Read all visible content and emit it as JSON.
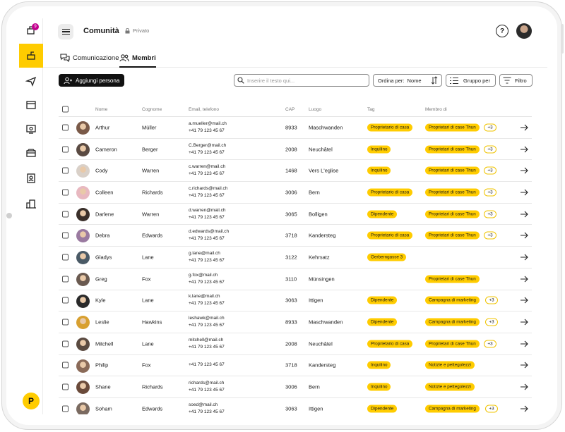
{
  "rail": {
    "items": [
      {
        "name": "notifications-icon",
        "badge": "9"
      },
      {
        "name": "community-icon"
      },
      {
        "name": "send-icon"
      },
      {
        "name": "news-icon"
      },
      {
        "name": "media-icon"
      },
      {
        "name": "inbox-icon"
      },
      {
        "name": "contacts-icon"
      },
      {
        "name": "buildings-icon"
      }
    ],
    "logo": "P"
  },
  "header": {
    "title": "Comunità",
    "privacy": "Privato"
  },
  "tabs": [
    {
      "label": "Comunicazione",
      "active": false
    },
    {
      "label": "Membri",
      "active": true
    }
  ],
  "toolbar": {
    "add_label": "Aggiungi persona",
    "search_placeholder": "Inserire il testo qui...",
    "sort_label": "Ordina per:",
    "sort_value": "Nome",
    "group_label": "Gruppo per",
    "filter_label": "Filtro"
  },
  "columns": [
    "Nome",
    "Cognome",
    "Email, telefono",
    "CAP",
    "Luogo",
    "Tag",
    "Membro di"
  ],
  "colors": {
    "accent": "#ffcc00",
    "badge": "#c2008e"
  },
  "rows": [
    {
      "first": "Arthur",
      "last": "Müller",
      "email": "a.mueller@mail.ch",
      "phone": "+41 79 123 45 67",
      "cap": "8933",
      "city": "Maschwanden",
      "tag": "Proprietario di casa",
      "member": "Proprietari di case Thun",
      "more": "+3",
      "avatar": "#7a5a48"
    },
    {
      "first": "Cameron",
      "last": "Berger",
      "email": "C.Berger@mail.ch",
      "phone": "+41 79 123 45 67",
      "cap": "2008",
      "city": "Neuchâtel",
      "tag": "Inquilino",
      "member": "Proprietari di case Thun",
      "more": "+3",
      "avatar": "#5a4a42"
    },
    {
      "first": "Cody",
      "last": "Warren",
      "email": "c.warren@mail.ch",
      "phone": "+41 79 123 45 67",
      "cap": "1468",
      "city": "Vers L'eglise",
      "tag": "Inquilino",
      "member": "Proprietari di case Thun",
      "more": "+3",
      "avatar": "#d9d0c8"
    },
    {
      "first": "Colleen",
      "last": "Richards",
      "email": "c.richards@mail.ch",
      "phone": "+41 79 123 45 67",
      "cap": "3006",
      "city": "Bern",
      "tag": "Proprietario di casa",
      "member": "Proprietari di case Thun",
      "more": "+3",
      "avatar": "#e8b8c0"
    },
    {
      "first": "Darlene",
      "last": "Warren",
      "email": "d.warren@mail.ch",
      "phone": "+41 79 123 45 67",
      "cap": "3065",
      "city": "Bolligen",
      "tag": "Dipendente",
      "member": "Proprietari di case Thun",
      "more": "+3",
      "avatar": "#3a2f2a"
    },
    {
      "first": "Debra",
      "last": "Edwards",
      "email": "d.edwards@mail.ch",
      "phone": "+41 79 123 45 67",
      "cap": "3718",
      "city": "Kandersteg",
      "tag": "Proprietario di casa",
      "member": "Proprietari di case Thun",
      "more": "+3",
      "avatar": "#9a7aa0"
    },
    {
      "first": "Gladys",
      "last": "Lane",
      "email": "g.lane@mail.ch",
      "phone": "+41 79 123 45 67",
      "cap": "3122",
      "city": "Kehrsatz",
      "tag": "Gerberngasse 3",
      "member": "",
      "more": "",
      "avatar": "#4a5a66"
    },
    {
      "first": "Greg",
      "last": "Fox",
      "email": "g.fox@mail.ch",
      "phone": "+41 79 123 45 67",
      "cap": "3110",
      "city": "Münsingen",
      "tag": "",
      "member": "Proprietari di case Thun",
      "more": "",
      "avatar": "#6a5a50"
    },
    {
      "first": "Kyle",
      "last": "Lane",
      "email": "k.lane@mail.ch",
      "phone": "+41 79 123 45 67",
      "cap": "3063",
      "city": "Ittigen",
      "tag": "Dipendente",
      "member": "Campagna di marketing",
      "more": "+3",
      "avatar": "#2a2a2a"
    },
    {
      "first": "Leslie",
      "last": "Hawkins",
      "email": "leshawk@mail.ch",
      "phone": "+41 79 123 45 67",
      "cap": "8933",
      "city": "Maschwanden",
      "tag": "Dipendente",
      "member": "Campagna di marketing",
      "more": "+3",
      "avatar": "#d8a030"
    },
    {
      "first": "Mitchell",
      "last": "Lane",
      "email": "mitchell@mail.ch",
      "phone": "+41 79 123 45 67",
      "cap": "2008",
      "city": "Neuchâtel",
      "tag": "Proprietario di casa",
      "member": "Proprietari di case Thun",
      "more": "+3",
      "avatar": "#5a4a40"
    },
    {
      "first": "Philip",
      "last": "Fox",
      "email": "",
      "phone": "+41 79 123 45 67",
      "cap": "3718",
      "city": "Kandersteg",
      "tag": "Inquilino",
      "member": "Notizie e pettegolezzi",
      "more": "",
      "avatar": "#8a6a58"
    },
    {
      "first": "Shane",
      "last": "Richards",
      "email": "richards@mail.ch",
      "phone": "+41 79 123 45 67",
      "cap": "3006",
      "city": "Bern",
      "tag": "Inquilino",
      "member": "Notizie e pettegolezzi",
      "more": "",
      "avatar": "#6a4a3a"
    },
    {
      "first": "Soham",
      "last": "Edwards",
      "email": "soed@mail.ch",
      "phone": "+41 79 123 45 67",
      "cap": "3063",
      "city": "Ittigen",
      "tag": "Dipendente",
      "member": "Campagna di marketing",
      "more": "+3",
      "avatar": "#7a6a60"
    }
  ]
}
